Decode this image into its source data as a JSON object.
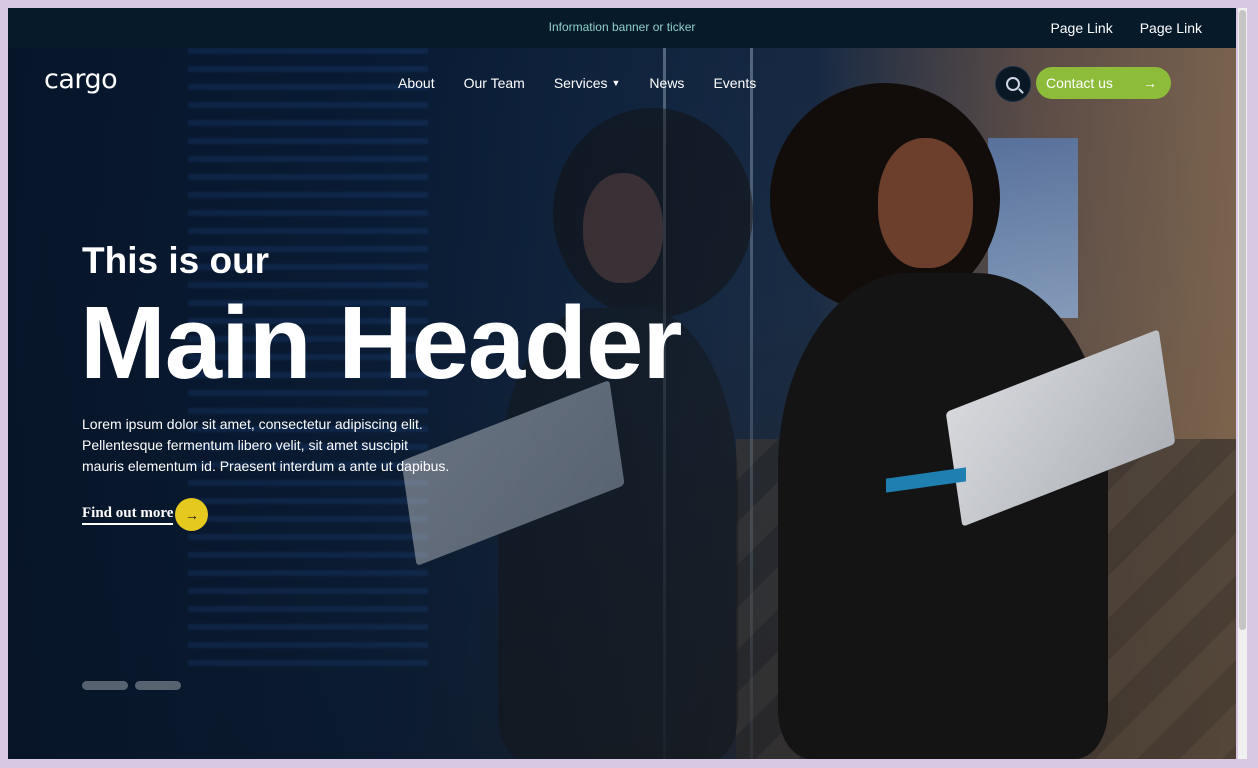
{
  "topbar": {
    "ticker": "Information banner or ticker",
    "links": [
      "Page Link",
      "Page Link"
    ]
  },
  "brand": {
    "logo": "cargo"
  },
  "nav": {
    "items": [
      {
        "label": "About"
      },
      {
        "label": "Our Team"
      },
      {
        "label": "Services",
        "has_dropdown": true
      },
      {
        "label": "News"
      },
      {
        "label": "Events"
      }
    ],
    "search_icon": "search-icon",
    "contact_label": "Contact us",
    "contact_icon": "arrow-right-icon"
  },
  "hero": {
    "kicker": "This is our",
    "title": "Main Header",
    "lede": "Lorem ipsum dolor sit amet, consectetur adipiscing elit. Pellentesque fermentum libero velit, sit amet suscipit mauris elementum id. Praesent interdum a ante ut dapibus.",
    "cta_label": "Find out more",
    "cta_icon": "arrow-right-icon",
    "slides_count": 2
  },
  "colors": {
    "accent_green": "#8dbb3a",
    "accent_yellow": "#e6c91e",
    "topbar_bg": "#071a2a",
    "ticker_text": "#8fd0c8"
  }
}
